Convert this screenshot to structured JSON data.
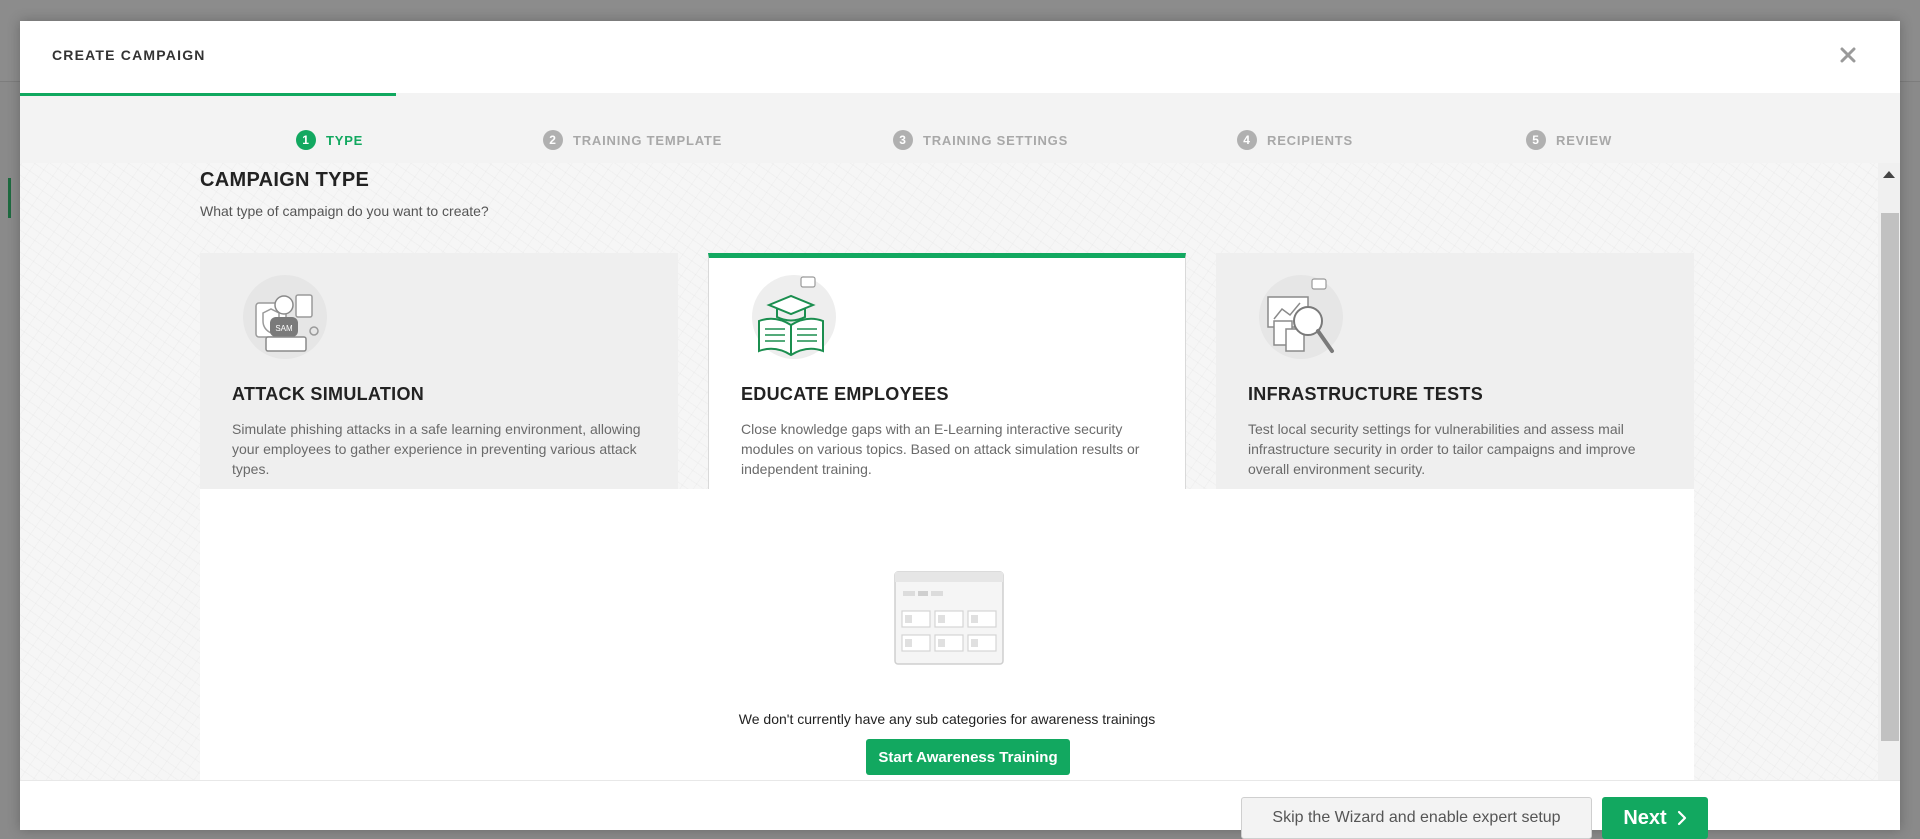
{
  "modal": {
    "title": "CREATE CAMPAIGN"
  },
  "steps": [
    {
      "number": "1",
      "label": "TYPE",
      "active": true
    },
    {
      "number": "2",
      "label": "TRAINING TEMPLATE",
      "active": false
    },
    {
      "number": "3",
      "label": "TRAINING SETTINGS",
      "active": false
    },
    {
      "number": "4",
      "label": "RECIPIENTS",
      "active": false
    },
    {
      "number": "5",
      "label": "REVIEW",
      "active": false
    }
  ],
  "section": {
    "title": "CAMPAIGN TYPE",
    "subtitle": "What type of campaign do you want to create?"
  },
  "cards": [
    {
      "title": "ATTACK SIMULATION",
      "description": "Simulate phishing attacks in a safe learning environment, allowing your employees to gather experience in preventing various attack types.",
      "icon": "hacker-laptop-icon",
      "selected": false
    },
    {
      "title": "EDUCATE EMPLOYEES",
      "description": "Close knowledge gaps with an E-Learning interactive security modules on various topics. Based on attack simulation results or independent training.",
      "icon": "graduation-book-icon",
      "selected": true
    },
    {
      "title": "INFRASTRUCTURE TESTS",
      "description": "Test local security settings for vulnerabilities and assess mail infrastructure security in order to tailor campaigns and improve overall environment security.",
      "icon": "magnifier-documents-icon",
      "selected": false
    }
  ],
  "empty_state": {
    "message": "We don't currently have any sub categories for awareness trainings",
    "button_label": "Start Awareness Training"
  },
  "footer": {
    "skip_label": "Skip the Wizard and enable expert setup",
    "next_label": "Next"
  },
  "colors": {
    "accent": "#12a860",
    "progress": "#10a85f"
  }
}
